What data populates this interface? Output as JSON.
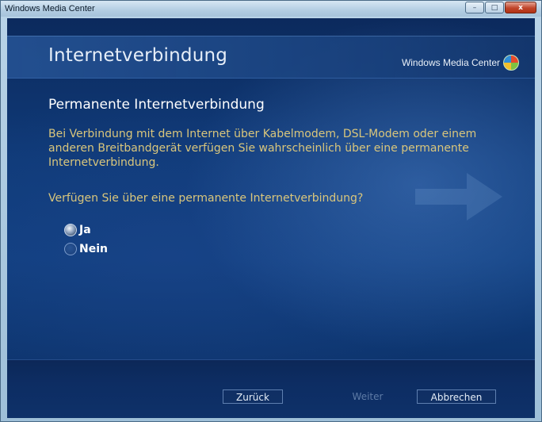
{
  "window": {
    "title": "Windows Media Center",
    "controls": {
      "minimize": "–",
      "maximize": "□",
      "close": "x"
    }
  },
  "header": {
    "title": "Internetverbindung",
    "brand": "Windows Media Center",
    "brand_icon": "windows-logo-icon"
  },
  "main": {
    "section_title": "Permanente Internetverbindung",
    "description": "Bei Verbindung mit dem Internet über Kabelmodem, DSL-Modem oder einem anderen Breitbandgerät verfügen Sie wahrscheinlich über eine permanente Internetverbindung.",
    "question": "Verfügen Sie über eine permanente Internetverbindung?",
    "options": [
      {
        "label": "Ja",
        "selected": true
      },
      {
        "label": "Nein",
        "selected": false
      }
    ]
  },
  "footer": {
    "back_label": "Zurück",
    "next_label": "Weiter",
    "cancel_label": "Abbrechen"
  },
  "colors": {
    "accent_text": "#d9c67c",
    "background": "#0f3a78",
    "close_button": "#c0452a"
  }
}
